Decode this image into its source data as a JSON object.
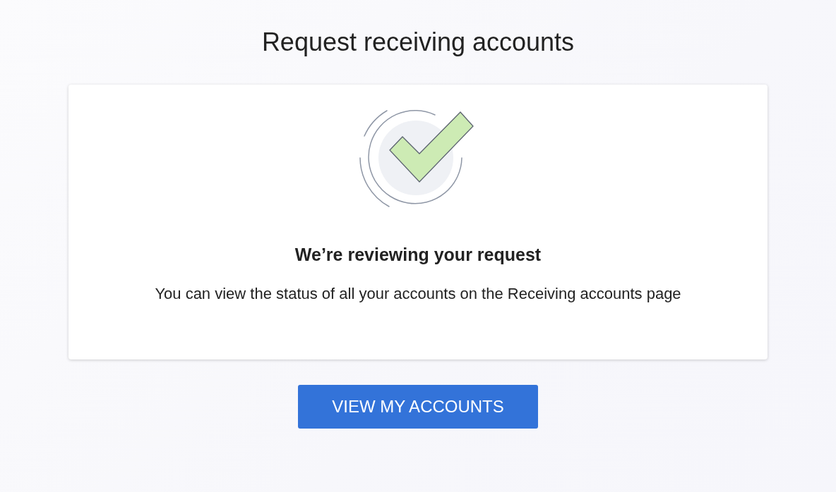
{
  "page": {
    "title": "Request receiving accounts"
  },
  "card": {
    "heading": "We’re reviewing your request",
    "message": "You can view the status of all your accounts on the Receiving accounts page"
  },
  "buttons": [
    {
      "label": "VIEW MY ACCOUNTS"
    }
  ]
}
